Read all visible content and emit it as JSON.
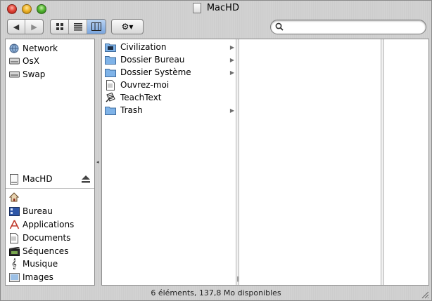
{
  "window": {
    "title": "MacHD"
  },
  "toolbar": {
    "back_glyph": "◀",
    "forward_glyph": "▶",
    "action_glyph": "⚙▾",
    "search": {
      "value": "",
      "placeholder": ""
    },
    "active_view": "column"
  },
  "sidebar": {
    "devices": [
      {
        "label": "Network",
        "icon": "network-globe-icon"
      },
      {
        "label": "OsX",
        "icon": "hard-disk-icon"
      },
      {
        "label": "Swap",
        "icon": "hard-disk-icon"
      }
    ],
    "volume": {
      "label": "MacHD",
      "icon": "disk-icon"
    },
    "places": [
      {
        "label": "",
        "icon": "home-icon"
      },
      {
        "label": "Bureau",
        "icon": "desktop-icon"
      },
      {
        "label": "Applications",
        "icon": "applications-icon"
      },
      {
        "label": "Documents",
        "icon": "documents-icon"
      },
      {
        "label": "Séquences",
        "icon": "movies-icon"
      },
      {
        "label": "Musique",
        "icon": "music-icon"
      },
      {
        "label": "Images",
        "icon": "pictures-icon"
      }
    ]
  },
  "browser": {
    "column1": [
      {
        "label": "Civilization",
        "icon": "folder-icon",
        "has_children": true
      },
      {
        "label": "Dossier Bureau",
        "icon": "folder-icon",
        "has_children": true
      },
      {
        "label": "Dossier Système",
        "icon": "folder-icon",
        "has_children": true
      },
      {
        "label": "Ouvrez-moi",
        "icon": "document-icon",
        "has_children": false
      },
      {
        "label": "TeachText",
        "icon": "teachtext-app-icon",
        "has_children": false
      },
      {
        "label": "Trash",
        "icon": "folder-icon",
        "has_children": true
      }
    ]
  },
  "status_bar": {
    "text": "6 éléments, 137,8 Mo disponibles"
  },
  "colors": {
    "selected_segment": "#79a5de",
    "folder_blue": "#7fb3e8"
  }
}
